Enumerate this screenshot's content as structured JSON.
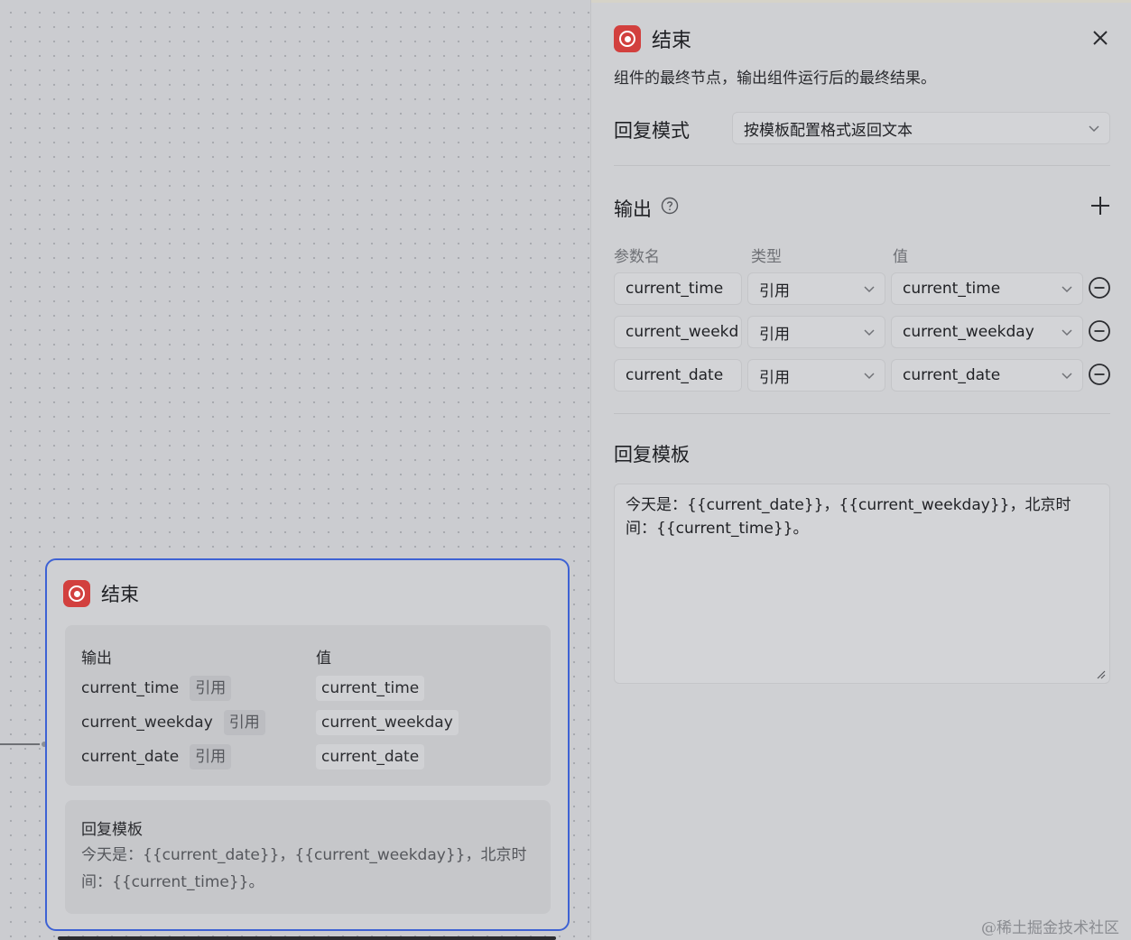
{
  "canvas": {
    "node": {
      "title": "结束",
      "output_header": "输出",
      "value_header": "值",
      "rows": [
        {
          "name": "current_time",
          "type": "引用",
          "value": "current_time"
        },
        {
          "name": "current_weekday",
          "type": "引用",
          "value": "current_weekday"
        },
        {
          "name": "current_date",
          "type": "引用",
          "value": "current_date"
        }
      ],
      "template_header": "回复模板",
      "template_text": "今天是：{{current_date}}，{{current_weekday}}，北京时间：{{current_time}}。"
    }
  },
  "panel": {
    "title": "结束",
    "description": "组件的最终节点，输出组件运行后的最终结果。",
    "reply_mode_label": "回复模式",
    "reply_mode_value": "按模板配置格式返回文本",
    "output_label": "输出",
    "columns": {
      "name": "参数名",
      "type": "类型",
      "value": "值"
    },
    "rows": [
      {
        "name": "current_time",
        "type": "引用",
        "value": "current_time"
      },
      {
        "name": "current_weekd",
        "type": "引用",
        "value": "current_weekday"
      },
      {
        "name": "current_date",
        "type": "引用",
        "value": "current_date"
      }
    ],
    "template_label": "回复模板",
    "template_text": "今天是：{{current_date}}，{{current_weekday}}，北京时间：{{current_time}}。"
  },
  "watermark": "@稀土掘金技术社区",
  "icons": {
    "end": "target-icon",
    "close": "close-icon",
    "help": "help-icon",
    "add": "plus-icon",
    "remove": "minus-circle-icon",
    "dropdown": "chevron-down-icon"
  },
  "colors": {
    "accent": "#3e62d4",
    "end_icon": "#d2403e"
  }
}
